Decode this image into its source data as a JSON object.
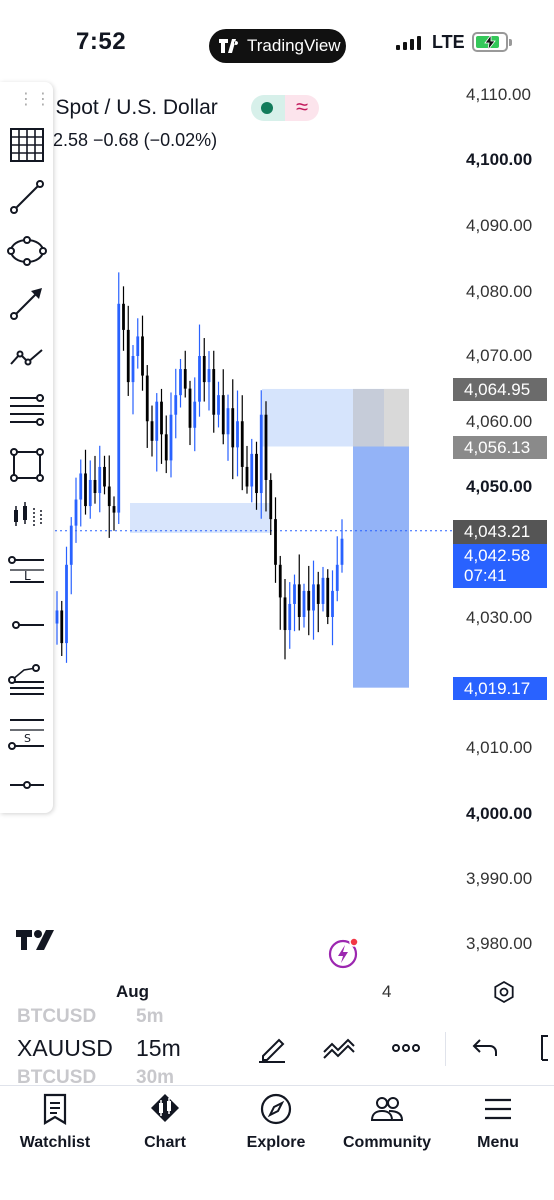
{
  "status_bar": {
    "time": "7:52",
    "app_pill": "TradingView",
    "network": "LTE"
  },
  "header": {
    "symbol_title": "d Spot / U.S. Dollar",
    "price_line": "2.58  −0.68 (−0.02%)"
  },
  "price_axis": {
    "labels": [
      "4,110.00",
      "4,100.00",
      "4,090.00",
      "4,080.00",
      "4,070.00",
      "4,060.00",
      "4,050.00",
      "4,030.00",
      "4,010.00",
      "4,000.00",
      "3,990.00",
      "3,980.00"
    ],
    "tags": {
      "upper": "4,064.95",
      "lower": "4,056.13",
      "crosshair": "4,043.21",
      "last_price": "4,042.58",
      "countdown": "07:41",
      "target": "4,019.17"
    }
  },
  "time_axis": {
    "labels": [
      "Aug",
      "4"
    ]
  },
  "symbol_picker": {
    "above": [
      "BTCUSD",
      "5m"
    ],
    "current": [
      "XAUUSD",
      "15m"
    ],
    "below": [
      "BTCUSD",
      "30m"
    ]
  },
  "bottom_nav": {
    "items": [
      {
        "label": "Watchlist",
        "icon": "watchlist-icon"
      },
      {
        "label": "Chart",
        "icon": "chart-icon"
      },
      {
        "label": "Explore",
        "icon": "compass-icon"
      },
      {
        "label": "Community",
        "icon": "people-icon"
      },
      {
        "label": "Menu",
        "icon": "menu-icon"
      }
    ]
  },
  "colors": {
    "bull_candle": "#2962ff",
    "bear_candle": "#000000",
    "zone_light": "#d6e4fc",
    "position_target": "#93b3f7",
    "tag_dark": "#6b6b6b",
    "tag_blue": "#2962ff"
  },
  "chart_data": {
    "type": "candlestick",
    "symbol": "XAUUSD",
    "timeframe": "15m",
    "ylim": [
      3975,
      4115
    ],
    "x_labels": [
      "Aug",
      "4"
    ],
    "close_path": [
      4031,
      4026,
      4038,
      4044,
      4048,
      4052,
      4047,
      4051,
      4049,
      4053,
      4050,
      4047,
      4046,
      4078,
      4074,
      4066,
      4070,
      4073,
      4067,
      4060,
      4057,
      4063,
      4058,
      4054,
      4061,
      4064,
      4068,
      4065,
      4059,
      4063,
      4070,
      4066,
      4068,
      4061,
      4064,
      4058,
      4062,
      4056,
      4060,
      4053,
      4050,
      4055,
      4049,
      4061,
      4051,
      4045,
      4038,
      4033,
      4028,
      4032,
      4035,
      4030,
      4034,
      4031,
      4035,
      4032,
      4036,
      4030,
      4034,
      4038,
      4042
    ],
    "price_levels": {
      "entry": 4056.13,
      "stop": 4064.95,
      "target": 4019.17,
      "last": 4042.58,
      "crosshair": 4043.21
    },
    "grid": false
  }
}
